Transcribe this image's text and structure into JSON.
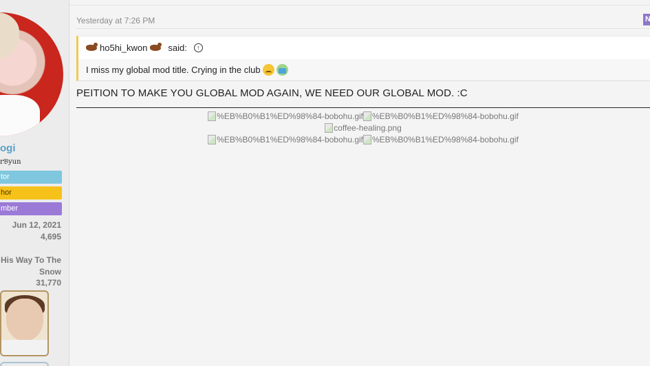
{
  "user": {
    "username": "ogi",
    "custom_title": "r𝔅yun",
    "banners": [
      "tor",
      "hor",
      "mber"
    ],
    "joined": "Jun 12, 2021",
    "messages": "4,695",
    "trophy_title": "His Way To The Snow",
    "points": "31,770"
  },
  "post": {
    "date": "Yesterday at 7:26 PM",
    "new_badge": "N",
    "quote": {
      "author": "ho5hi_kwon",
      "said": "said:",
      "text": "I miss my global mod title. Crying in the club"
    },
    "body": "PEITION TO MAKE YOU GLOBAL MOD AGAIN, WE NEED OUR GLOBAL MOD. :C"
  },
  "signature": {
    "row1": [
      "%EB%B0%B1%ED%98%84-bobohu.gif",
      "%EB%B0%B1%ED%98%84-bobohu.gif"
    ],
    "row2": [
      "coffee-healing.png"
    ],
    "row3": [
      "%EB%B0%B1%ED%98%84-bobohu.gif",
      "%EB%B0%B1%ED%98%84-bobohu.gif"
    ]
  },
  "colors": {
    "accent": "#8e77c9",
    "username": "#5aa0c8",
    "banner_1": "#7ec7df",
    "banner_2": "#f6c21a",
    "banner_3": "#9b7ad7",
    "quote_border": "#f2c94c"
  }
}
